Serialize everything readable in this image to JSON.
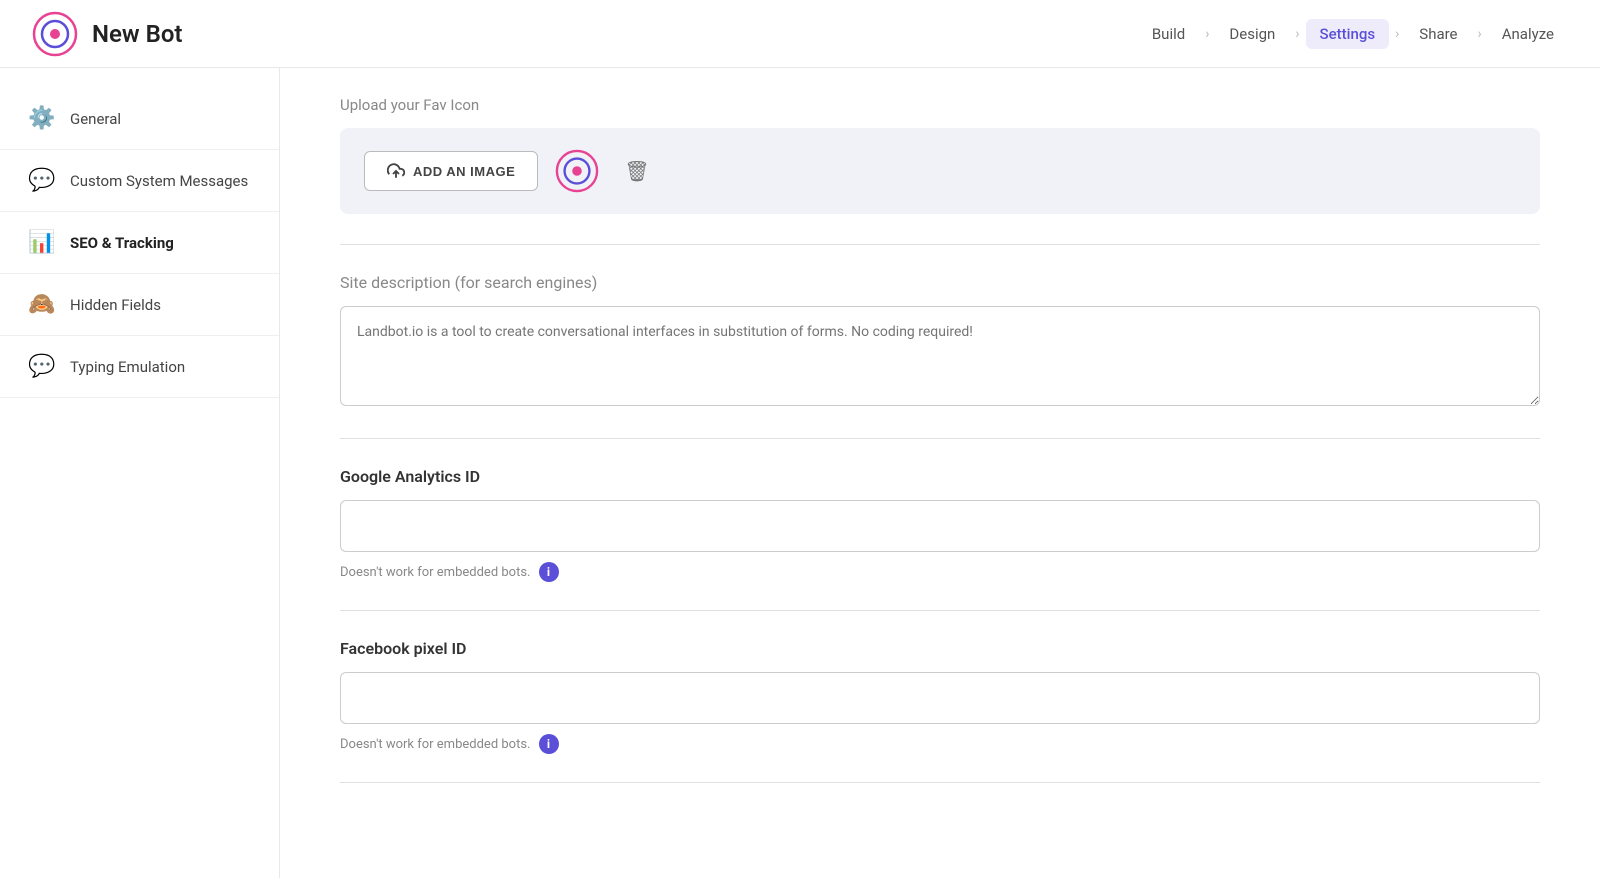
{
  "header": {
    "bot_name": "New Bot",
    "nav_items": [
      {
        "id": "build",
        "label": "Build",
        "active": false
      },
      {
        "id": "design",
        "label": "Design",
        "active": false
      },
      {
        "id": "settings",
        "label": "Settings",
        "active": true
      },
      {
        "id": "share",
        "label": "Share",
        "active": false
      },
      {
        "id": "analyze",
        "label": "Analyze",
        "active": false
      }
    ]
  },
  "sidebar": {
    "items": [
      {
        "id": "general",
        "label": "General",
        "icon": "⚙️"
      },
      {
        "id": "custom-system-messages",
        "label": "Custom System Messages",
        "icon": "💬"
      },
      {
        "id": "seo-tracking",
        "label": "SEO & Tracking",
        "icon": "📊",
        "active": true
      },
      {
        "id": "hidden-fields",
        "label": "Hidden Fields",
        "icon": "🙈"
      },
      {
        "id": "typing-emulation",
        "label": "Typing Emulation",
        "icon": "💬"
      }
    ]
  },
  "main": {
    "upload_favicon_label": "Upload your Fav Icon",
    "add_image_button": "ADD AN IMAGE",
    "site_description_label": "Site description",
    "site_description_sub": "(for search engines)",
    "site_description_placeholder": "Landbot.io is a tool to create conversational interfaces in substitution of forms. No coding required!",
    "google_analytics_label": "Google Analytics ID",
    "google_analytics_hint": "Doesn't work for embedded bots.",
    "facebook_pixel_label": "Facebook pixel ID",
    "facebook_pixel_hint": "Doesn't work for embedded bots."
  }
}
